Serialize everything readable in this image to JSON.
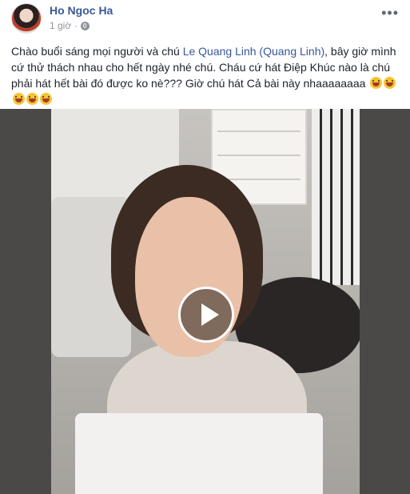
{
  "post": {
    "author": "Ho Ngoc Ha",
    "time": "1 giờ",
    "more_label": "•••",
    "text_part1": "Chào buổi sáng mọi người và chú ",
    "mention": "Le Quang Linh (Quang Linh)",
    "text_part2": ", bây giờ mình cứ thử thách nhau cho hết ngày nhé chú. Cháu cứ hát Điệp Khúc nào là chú phải hát hết bài đó được ko nè??? Giờ chú hát Cả bài này nhaaaaaaaa"
  },
  "icons": {
    "avatar": "profile-picture",
    "globe": "globe-icon",
    "emoji": "grinning-face-with-sweat",
    "play": "play-icon"
  },
  "colors": {
    "link": "#385898",
    "muted": "#90949c",
    "text": "#1d2129"
  }
}
